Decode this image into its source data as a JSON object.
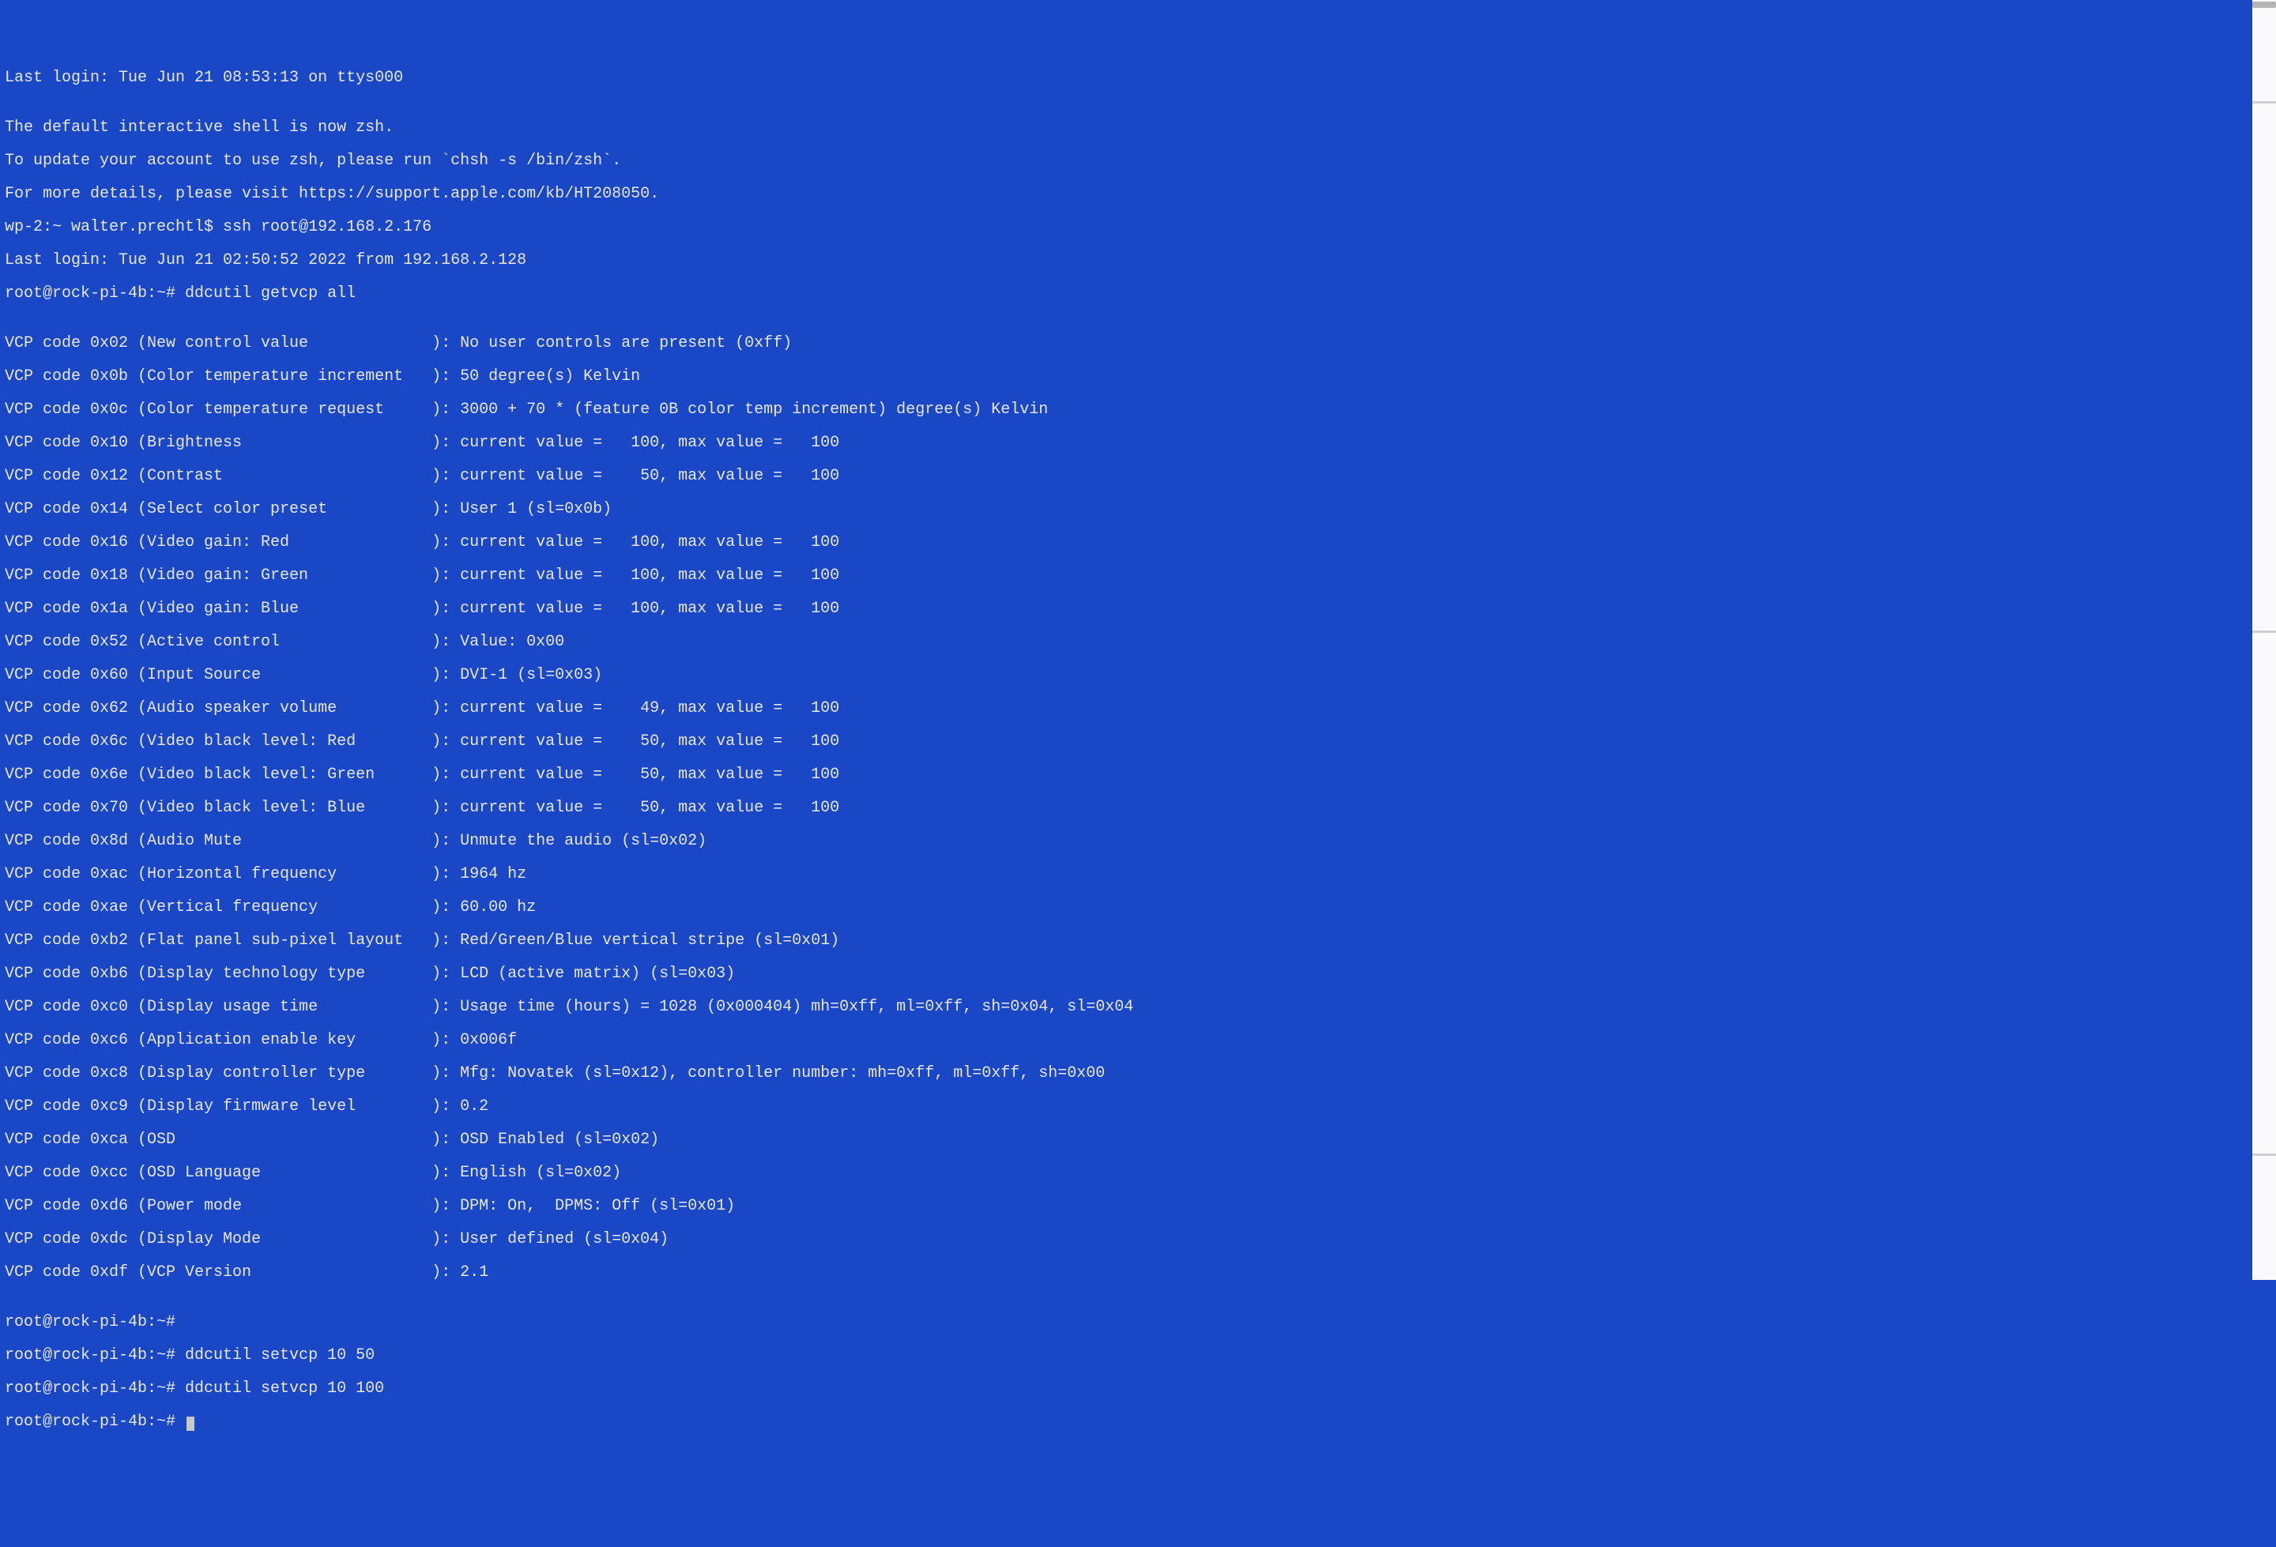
{
  "session": {
    "last_login_local": "Last login: Tue Jun 21 08:53:13 on ttys000",
    "blank1": "",
    "zsh_notice1": "The default interactive shell is now zsh.",
    "zsh_notice2": "To update your account to use zsh, please run `chsh -s /bin/zsh`.",
    "zsh_notice3": "For more details, please visit https://support.apple.com/kb/HT208050.",
    "local_prompt_ssh": "wp-2:~ walter.prechtl$ ssh root@192.168.2.176",
    "remote_last_login": "Last login: Tue Jun 21 02:50:52 2022 from 192.168.2.128",
    "cmd_getvcp": "root@rock-pi-4b:~# ddcutil getvcp all"
  },
  "vcp": [
    "VCP code 0x02 (New control value             ): No user controls are present (0xff)",
    "VCP code 0x0b (Color temperature increment   ): 50 degree(s) Kelvin",
    "VCP code 0x0c (Color temperature request     ): 3000 + 70 * (feature 0B color temp increment) degree(s) Kelvin",
    "VCP code 0x10 (Brightness                    ): current value =   100, max value =   100",
    "VCP code 0x12 (Contrast                      ): current value =    50, max value =   100",
    "VCP code 0x14 (Select color preset           ): User 1 (sl=0x0b)",
    "VCP code 0x16 (Video gain: Red               ): current value =   100, max value =   100",
    "VCP code 0x18 (Video gain: Green             ): current value =   100, max value =   100",
    "VCP code 0x1a (Video gain: Blue              ): current value =   100, max value =   100",
    "VCP code 0x52 (Active control                ): Value: 0x00",
    "VCP code 0x60 (Input Source                  ): DVI-1 (sl=0x03)",
    "VCP code 0x62 (Audio speaker volume          ): current value =    49, max value =   100",
    "VCP code 0x6c (Video black level: Red        ): current value =    50, max value =   100",
    "VCP code 0x6e (Video black level: Green      ): current value =    50, max value =   100",
    "VCP code 0x70 (Video black level: Blue       ): current value =    50, max value =   100",
    "VCP code 0x8d (Audio Mute                    ): Unmute the audio (sl=0x02)",
    "VCP code 0xac (Horizontal frequency          ): 1964 hz",
    "VCP code 0xae (Vertical frequency            ): 60.00 hz",
    "VCP code 0xb2 (Flat panel sub-pixel layout   ): Red/Green/Blue vertical stripe (sl=0x01)",
    "VCP code 0xb6 (Display technology type       ): LCD (active matrix) (sl=0x03)",
    "VCP code 0xc0 (Display usage time            ): Usage time (hours) = 1028 (0x000404) mh=0xff, ml=0xff, sh=0x04, sl=0x04",
    "VCP code 0xc6 (Application enable key        ): 0x006f",
    "VCP code 0xc8 (Display controller type       ): Mfg: Novatek (sl=0x12), controller number: mh=0xff, ml=0xff, sh=0x00",
    "VCP code 0xc9 (Display firmware level        ): 0.2",
    "VCP code 0xca (OSD                           ): OSD Enabled (sl=0x02)",
    "VCP code 0xcc (OSD Language                  ): English (sl=0x02)",
    "VCP code 0xd6 (Power mode                    ): DPM: On,  DPMS: Off (sl=0x01)",
    "VCP code 0xdc (Display Mode                  ): User defined (sl=0x04)",
    "VCP code 0xdf (VCP Version                   ): 2.1"
  ],
  "post": {
    "prompt_empty": "root@rock-pi-4b:~#",
    "cmd_set50": "root@rock-pi-4b:~# ddcutil setvcp 10 50",
    "cmd_set100": "root@rock-pi-4b:~# ddcutil setvcp 10 100",
    "prompt_cursor": "root@rock-pi-4b:~# "
  }
}
